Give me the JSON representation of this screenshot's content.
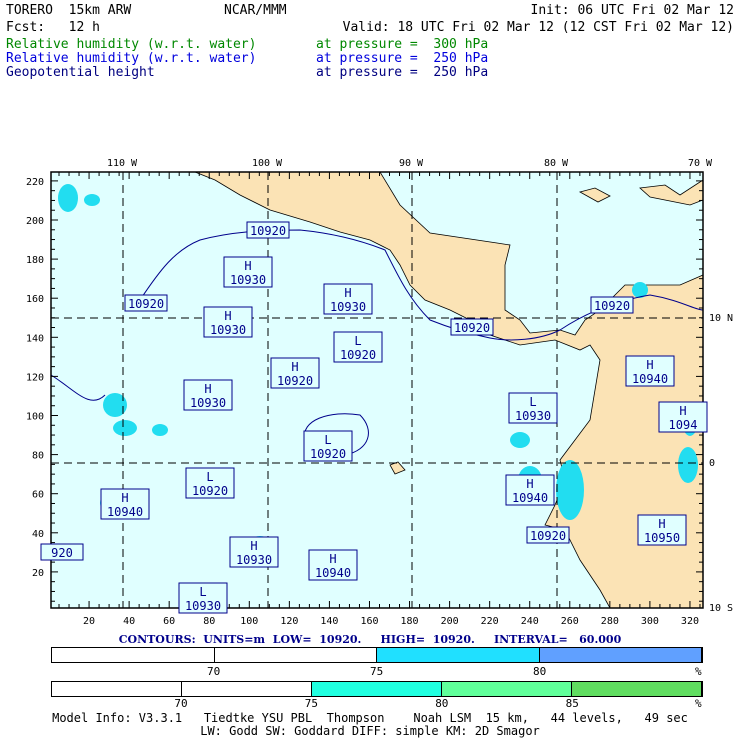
{
  "header": {
    "model": "TORERO  15km ARW",
    "center": "NCAR/MMM",
    "init": "Init: 06 UTC Fri 02 Mar 12",
    "fcst": "Fcst:   12 h",
    "valid": "Valid: 18 UTC Fri 02 Mar 12 (12 CST Fri 02 Mar 12)"
  },
  "fields": [
    {
      "name": "Relative humidity (w.r.t. water)",
      "level": "at pressure =  300 hPa",
      "color": "#008800"
    },
    {
      "name": "Relative humidity (w.r.t. water)",
      "level": "at pressure =  250 hPa",
      "color": "#0000dd"
    },
    {
      "name": "Geopotential height",
      "level": "at pressure =  250 hPa",
      "color": "#000080"
    }
  ],
  "map": {
    "top_labels": [
      "110 W",
      "100 W",
      "90 W",
      "80 W",
      "70 W"
    ],
    "right_labels": [
      "10 N",
      "0",
      "10 S"
    ],
    "x_ticks": [
      "20",
      "40",
      "60",
      "80",
      "100",
      "120",
      "140",
      "160",
      "180",
      "200",
      "220",
      "240",
      "260",
      "280",
      "300",
      "320"
    ],
    "y_ticks": [
      "20",
      "40",
      "60",
      "80",
      "100",
      "120",
      "140",
      "160",
      "180",
      "200",
      "220"
    ],
    "colors": {
      "ocean": "#e0ffff",
      "land": "#fbe3b5",
      "contour": "#00008b",
      "rh300": "#20ffe0",
      "rh250": "#22ddf0"
    },
    "contour_labels": [
      "10920",
      "10920",
      "H 10930",
      "H 10930",
      "H 10930",
      "10920",
      "10920",
      "L 10920",
      "H 10920",
      "H 10930",
      "L 10920",
      "L 10930",
      "H 10940",
      "H 10940",
      "L 10920",
      "H 10940",
      "10920",
      "H 10950",
      "H 10930",
      "H 10940",
      "920",
      "L 10930",
      "H 1094"
    ]
  },
  "contour_info": "CONTOURS:  UNITS=m  LOW=  10920.     HIGH=  10920.     INTERVAL=   60.000",
  "bar1": {
    "ticks": [
      "70",
      "75",
      "80",
      "%"
    ],
    "colors": [
      "#ffffff",
      "#ffffff",
      "#20e0ff",
      "#60a0ff"
    ]
  },
  "bar2": {
    "ticks": [
      "70",
      "75",
      "80",
      "85",
      "%"
    ],
    "colors": [
      "#ffffff",
      "#ffffff",
      "#20ffe0",
      "#60ff9a",
      "#60dd60"
    ]
  },
  "model_info": {
    "line1": "Model Info: V3.3.1   Tiedtke YSU PBL  Thompson    Noah LSM  15 km,   44 levels,   49 sec",
    "line2": "LW: Godd SW: Goddard DIFF: simple KM: 2D Smagor"
  }
}
